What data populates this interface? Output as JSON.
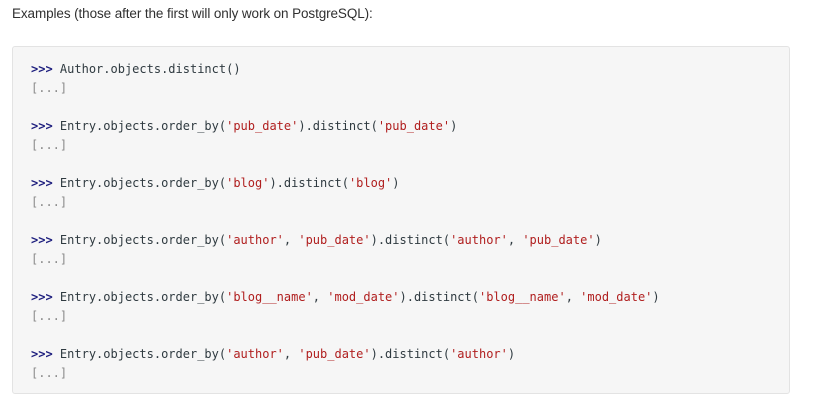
{
  "intro_text": "Examples (those after the first will only work on PostgreSQL):",
  "prompt": ">>>",
  "output_placeholder": "[...]",
  "examples": [
    {
      "tokens": [
        {
          "t": "code",
          "v": "Author.objects.distinct()"
        }
      ]
    },
    {
      "tokens": [
        {
          "t": "code",
          "v": "Entry.objects.order_by("
        },
        {
          "t": "str",
          "v": "'pub_date'"
        },
        {
          "t": "code",
          "v": ").distinct("
        },
        {
          "t": "str",
          "v": "'pub_date'"
        },
        {
          "t": "code",
          "v": ")"
        }
      ]
    },
    {
      "tokens": [
        {
          "t": "code",
          "v": "Entry.objects.order_by("
        },
        {
          "t": "str",
          "v": "'blog'"
        },
        {
          "t": "code",
          "v": ").distinct("
        },
        {
          "t": "str",
          "v": "'blog'"
        },
        {
          "t": "code",
          "v": ")"
        }
      ]
    },
    {
      "tokens": [
        {
          "t": "code",
          "v": "Entry.objects.order_by("
        },
        {
          "t": "str",
          "v": "'author'"
        },
        {
          "t": "code",
          "v": ", "
        },
        {
          "t": "str",
          "v": "'pub_date'"
        },
        {
          "t": "code",
          "v": ").distinct("
        },
        {
          "t": "str",
          "v": "'author'"
        },
        {
          "t": "code",
          "v": ", "
        },
        {
          "t": "str",
          "v": "'pub_date'"
        },
        {
          "t": "code",
          "v": ")"
        }
      ]
    },
    {
      "tokens": [
        {
          "t": "code",
          "v": "Entry.objects.order_by("
        },
        {
          "t": "str",
          "v": "'blog__name'"
        },
        {
          "t": "code",
          "v": ", "
        },
        {
          "t": "str",
          "v": "'mod_date'"
        },
        {
          "t": "code",
          "v": ").distinct("
        },
        {
          "t": "str",
          "v": "'blog__name'"
        },
        {
          "t": "code",
          "v": ", "
        },
        {
          "t": "str",
          "v": "'mod_date'"
        },
        {
          "t": "code",
          "v": ")"
        }
      ]
    },
    {
      "tokens": [
        {
          "t": "code",
          "v": "Entry.objects.order_by("
        },
        {
          "t": "str",
          "v": "'author'"
        },
        {
          "t": "code",
          "v": ", "
        },
        {
          "t": "str",
          "v": "'pub_date'"
        },
        {
          "t": "code",
          "v": ").distinct("
        },
        {
          "t": "str",
          "v": "'author'"
        },
        {
          "t": "code",
          "v": ")"
        }
      ]
    }
  ],
  "colors": {
    "prompt": "#1d1e7e",
    "string": "#b01e1e",
    "code": "#2f3a40",
    "ellipsis": "#8a8a8a",
    "block_background": "#f6f6f6"
  }
}
